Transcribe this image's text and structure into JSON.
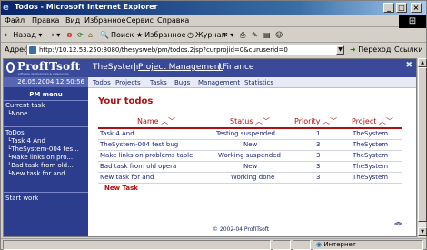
{
  "window": {
    "title": "Todos - Microsoft Internet Explorer"
  },
  "menu": [
    "Файл",
    "Правка",
    "Вид",
    "Избранное",
    "Сервис",
    "Справка"
  ],
  "toolbar": {
    "back": "Назад",
    "search": "Поиск",
    "favorites": "Избранное",
    "journal": "Журнал"
  },
  "address": {
    "label": "Адрес",
    "url": "http://10.12.53.250:8080/thesysweb/pm/todos.2jsp?curprojid=0&curuserid=0",
    "go": "Переход",
    "links": "Ссылки"
  },
  "app": {
    "logo": "ProfITsoft",
    "tagline": "software development & outsourcing",
    "date": "26.05.2004 12:50:56",
    "top_nav": [
      "TheSystem",
      "Project Management",
      "Finance"
    ],
    "sub_nav": [
      "Todos",
      "Projects",
      "Tasks",
      "Bugs",
      "Management",
      "Statistics"
    ],
    "close": "x"
  },
  "sidebar": {
    "pm_menu": "PM menu",
    "current_task_label": "Current task",
    "current_task_value": "└None",
    "todos_label": "ToDos",
    "todos": [
      "Task 4 And",
      "TheSystem-004 tes...",
      "Make links on pro...",
      "Bad task from old...",
      "New task for and"
    ],
    "start_work": "Start work"
  },
  "main": {
    "heading": "Your todos",
    "columns": [
      "Name",
      "Status",
      "Priority",
      "Project"
    ],
    "rows": [
      {
        "name": "Task 4 And",
        "status": "Testing suspended",
        "priority": "1",
        "project": "TheSystem"
      },
      {
        "name": "TheSystem-004 test bug",
        "status": "New",
        "priority": "3",
        "project": "TheSystem"
      },
      {
        "name": "Make links on problems table",
        "status": "Working suspended",
        "priority": "3",
        "project": "TheSystem"
      },
      {
        "name": "Bad task from old opera",
        "status": "New",
        "priority": "3",
        "project": "TheSystem"
      },
      {
        "name": "New task for and",
        "status": "Working done",
        "priority": "3",
        "project": "TheSystem"
      }
    ],
    "new_task": "New Task",
    "footer": "© 2002-04 ProfITsoft"
  },
  "status": {
    "zone": "Интернет"
  },
  "colors": {
    "brand_navy": "#2b3d8c",
    "accent_red": "#b01010"
  }
}
